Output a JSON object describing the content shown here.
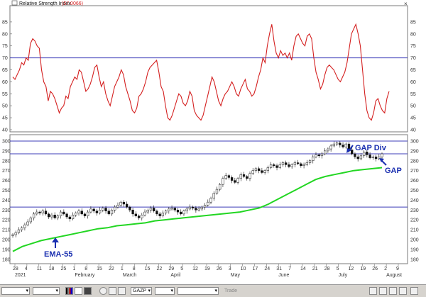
{
  "panel_title": "Relative Strength Index",
  "panel_title_value": "(57.0066)",
  "chart_data": [
    {
      "type": "line",
      "panel": "rsi",
      "ylim": [
        40,
        90
      ],
      "yticks": [
        40,
        45,
        50,
        55,
        60,
        65,
        70,
        75,
        80,
        85
      ],
      "hlines": [
        70
      ],
      "colors": {
        "rsi": "#d42020",
        "hline": "#3d3db8"
      },
      "series": [
        {
          "values": [
            62,
            61,
            63,
            65,
            68,
            67,
            70,
            69,
            76,
            78,
            77,
            75,
            74,
            65,
            60,
            58,
            52,
            56,
            55,
            53,
            50,
            47,
            49,
            50,
            54,
            53,
            58,
            60,
            62,
            61,
            65,
            64,
            60,
            56,
            57,
            59,
            62,
            66,
            67,
            62,
            58,
            60,
            55,
            52,
            50,
            54,
            58,
            60,
            62,
            65,
            63,
            58,
            55,
            52,
            48,
            47,
            49,
            54,
            55,
            57,
            60,
            64,
            66,
            67,
            68,
            69,
            64,
            58,
            56,
            50,
            45,
            44,
            46,
            49,
            52,
            55,
            54,
            51,
            50,
            52,
            56,
            54,
            48,
            46,
            45,
            44,
            46,
            50,
            54,
            58,
            62,
            60,
            56,
            52,
            50,
            53,
            55,
            56,
            58,
            60,
            58,
            55,
            54,
            57,
            59,
            61,
            57,
            56,
            54,
            55,
            58,
            62,
            65,
            70,
            68,
            75,
            80,
            84,
            77,
            72,
            70,
            73,
            71,
            72,
            70,
            72,
            69,
            75,
            79,
            80,
            78,
            76,
            75,
            79,
            80,
            78,
            70,
            64,
            61,
            57,
            59,
            63,
            66,
            67,
            66,
            65,
            63,
            61,
            60,
            62,
            64,
            68,
            74,
            80,
            82,
            84,
            80,
            75,
            65,
            55,
            48,
            45,
            44,
            47,
            52,
            53,
            50,
            48,
            47,
            53,
            56
          ]
        }
      ]
    },
    {
      "type": "candlestick",
      "panel": "price",
      "ylim": [
        177,
        305
      ],
      "yticks": [
        180,
        190,
        200,
        210,
        220,
        230,
        240,
        250,
        260,
        270,
        280,
        290,
        300
      ],
      "hlines": [
        300,
        287,
        233
      ],
      "colors": {
        "ema": "#22d622",
        "hline": "#3d3db8",
        "candle": "#111111"
      },
      "x_tick_labels": [
        "28",
        "4",
        "11",
        "18",
        "25",
        "1",
        "8",
        "15",
        "22",
        "1",
        "8",
        "15",
        "22",
        "29",
        "5",
        "12",
        "19",
        "26",
        "3",
        "10",
        "17",
        "24",
        "31",
        "7",
        "14",
        "21",
        "28",
        "5",
        "12",
        "19",
        "26",
        "2",
        "9"
      ],
      "month_labels": [
        "2021",
        "February",
        "March",
        "April",
        "May",
        "June",
        "July",
        "August"
      ],
      "close": [
        205,
        207,
        210,
        212,
        215,
        218,
        222,
        226,
        228,
        227,
        229,
        226,
        223,
        225,
        222,
        224,
        228,
        226,
        223,
        221,
        225,
        227,
        229,
        226,
        224,
        228,
        231,
        229,
        227,
        230,
        232,
        229,
        226,
        230,
        233,
        235,
        238,
        236,
        233,
        230,
        226,
        224,
        222,
        225,
        228,
        230,
        232,
        229,
        226,
        224,
        227,
        229,
        231,
        232,
        230,
        228,
        226,
        229,
        231,
        233,
        232,
        230,
        231,
        233,
        235,
        238,
        242,
        247,
        251,
        256,
        262,
        265,
        263,
        260,
        258,
        262,
        266,
        264,
        262,
        267,
        270,
        272,
        270,
        268,
        270,
        273,
        276,
        275,
        273,
        276,
        278,
        276,
        274,
        276,
        278,
        277,
        275,
        276,
        278,
        280,
        284,
        286,
        285,
        287,
        290,
        292,
        295,
        297,
        298,
        296,
        294,
        297,
        291,
        287,
        284,
        282,
        285,
        289,
        286,
        283,
        284,
        282,
        284,
        287
      ],
      "ema55": [
        188,
        193,
        196,
        199,
        201,
        203,
        205,
        207,
        209,
        211,
        212,
        214,
        215,
        216,
        217,
        219,
        220,
        221,
        222,
        223,
        224,
        225,
        226,
        227,
        228,
        230,
        232,
        236,
        241,
        246,
        251,
        256,
        261,
        264,
        266,
        268,
        270,
        271,
        272,
        273
      ],
      "annotations": [
        {
          "text": "EMA-55",
          "arrow": "up"
        },
        {
          "text": "GAP Div",
          "arrow": "down-left"
        },
        {
          "text": "GAP",
          "arrow": "up-left"
        }
      ]
    }
  ],
  "toolbar": {
    "symbol": "GAZP",
    "trade_label": "Trade"
  }
}
